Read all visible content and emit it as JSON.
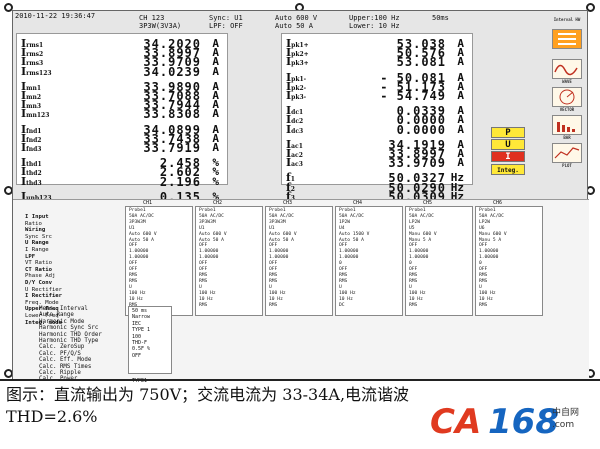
{
  "status": {
    "datetime": "2010-11-22 19:36:47",
    "channel": "CH 123",
    "wiring": "3P3W(3V3A)",
    "sync": "Sync: U1",
    "lpf": "LPF: OFF",
    "v_range": "Auto 600 V",
    "a_range": "Auto  50 A",
    "upper": "Upper:100 Hz",
    "lower": "Lower: 10 Hz",
    "interval": "50ms"
  },
  "left_rows": [
    {
      "sym": "I",
      "sub": "rms1",
      "val": "34.2020",
      "unit": "A"
    },
    {
      "sym": "I",
      "sub": "rms2",
      "val": "33.8997",
      "unit": "A"
    },
    {
      "sym": "I",
      "sub": "rms3",
      "val": "33.9709",
      "unit": "A"
    },
    {
      "sym": "I",
      "sub": "rms123",
      "val": "34.0239",
      "unit": "A"
    },
    {
      "sym": "I",
      "sub": "mn1",
      "val": "33.9890",
      "unit": "A"
    },
    {
      "sym": "I",
      "sub": "mn2",
      "val": "33.7088",
      "unit": "A"
    },
    {
      "sym": "I",
      "sub": "mn3",
      "val": "33.7944",
      "unit": "A"
    },
    {
      "sym": "I",
      "sub": "mn123",
      "val": "33.8308",
      "unit": "A"
    },
    {
      "sym": "I",
      "sub": "fnd1",
      "val": "34.0899",
      "unit": "A"
    },
    {
      "sym": "I",
      "sub": "fnd2",
      "val": "33.7438",
      "unit": "A"
    },
    {
      "sym": "I",
      "sub": "fnd3",
      "val": "33.7919",
      "unit": "A"
    },
    {
      "sym": "I",
      "sub": "thd1",
      "val": "2.458",
      "unit": "%"
    },
    {
      "sym": "I",
      "sub": "thd2",
      "val": "2.602",
      "unit": "%"
    },
    {
      "sym": "I",
      "sub": "thd3",
      "val": "2.196",
      "unit": "%"
    },
    {
      "sym": "I",
      "sub": "unb123",
      "val": "0.135",
      "unit": "%"
    }
  ],
  "right_rows": [
    {
      "sym": "I",
      "sub": "pk1+",
      "val": "53.038",
      "unit": "A"
    },
    {
      "sym": "I",
      "sub": "pk2+",
      "val": "50.576",
      "unit": "A"
    },
    {
      "sym": "I",
      "sub": "pk3+",
      "val": "53.081",
      "unit": "A"
    },
    {
      "sym": "I",
      "sub": "pk1-",
      "val": "- 50.081",
      "unit": "A"
    },
    {
      "sym": "I",
      "sub": "pk2-",
      "val": "- 51.173",
      "unit": "A"
    },
    {
      "sym": "I",
      "sub": "pk3-",
      "val": "- 54.749",
      "unit": "A"
    },
    {
      "sym": "I",
      "sub": "dc1",
      "val": "0.0339",
      "unit": "A"
    },
    {
      "sym": "I",
      "sub": "dc2",
      "val": "0.0000",
      "unit": "A"
    },
    {
      "sym": "I",
      "sub": "dc3",
      "val": "0.0000",
      "unit": "A"
    },
    {
      "sym": "I",
      "sub": "ac1",
      "val": "34.1919",
      "unit": "A"
    },
    {
      "sym": "I",
      "sub": "ac2",
      "val": "33.8997",
      "unit": "A"
    },
    {
      "sym": "I",
      "sub": "ac3",
      "val": "33.9709",
      "unit": "A"
    },
    {
      "sym": "f",
      "sub": "1",
      "val": "50.0327",
      "unit": "Hz"
    },
    {
      "sym": "f",
      "sub": "2",
      "val": "50.0290",
      "unit": "Hz"
    },
    {
      "sym": "f",
      "sub": "3",
      "val": "50.0309",
      "unit": "Hz"
    }
  ],
  "pui": {
    "p": "P",
    "u": "U",
    "i": "I",
    "integ": "Integ."
  },
  "sidebar": {
    "title": "Interval HW",
    "wave": "WAVE",
    "vector": "VECTOR",
    "bar": "BAR",
    "trend": "PLOT"
  },
  "setting_labels": [
    "I Input",
    "Ratio",
    "Wiring",
    "Sync Src",
    "U Range",
    "I Range",
    "LPF",
    "VT Ratio",
    "CT Ratio",
    "Phase Adj",
    "D/Y Conv",
    "U Rectifier",
    "I Rectifier",
    "Freq. Mode",
    "Upper Freq",
    "Lower Freq",
    "Integ. mode"
  ],
  "channels": [
    {
      "name": "CH1",
      "vals": [
        "Probe1",
        "50A AC/DC",
        "3P3W3M",
        "U1",
        "Auto 600 V",
        "Auto 50 A",
        "OFF",
        "1.00000",
        "1.00000",
        "OFF",
        "OFF",
        "RMS",
        "RMS",
        "U",
        "100 Hz",
        "10 Hz",
        "RMS"
      ]
    },
    {
      "name": "CH2",
      "vals": [
        "Probe1",
        "50A AC/DC",
        "3P3W3M",
        "U1",
        "Auto 600 V",
        "Auto 50 A",
        "OFF",
        "1.00000",
        "1.00000",
        "OFF",
        "OFF",
        "RMS",
        "RMS",
        "U",
        "100 Hz",
        "10 Hz",
        "RMS"
      ]
    },
    {
      "name": "CH3",
      "vals": [
        "Probe1",
        "50A AC/DC",
        "3P3W3M",
        "U1",
        "Auto 600 V",
        "Auto 50 A",
        "OFF",
        "1.00000",
        "1.00000",
        "OFF",
        "OFF",
        "RMS",
        "RMS",
        "U",
        "100 Hz",
        "10 Hz",
        "RMS"
      ]
    },
    {
      "name": "CH4",
      "vals": [
        "Probe1",
        "50A AC/DC",
        "1P2W",
        "U4",
        "Auto 1500 V",
        "Auto 50 A",
        "OFF",
        "1.00000",
        "1.00000",
        "0",
        "OFF",
        "RMS",
        "RMS",
        "U",
        "100 Hz",
        "10 Hz",
        "DC"
      ]
    },
    {
      "name": "CH5",
      "vals": [
        "Probe1",
        "50A AC/DC",
        "LP2W",
        "U5",
        "Manu 600 V",
        "Manu 5 A",
        "OFF",
        "1.00000",
        "1.00000",
        "0",
        "OFF",
        "RMS",
        "RMS",
        "U",
        "100 Hz",
        "10 Hz",
        "RMS"
      ]
    },
    {
      "name": "CH6",
      "vals": [
        "Probe1",
        "50A AC/DC",
        "LP2W",
        "U6",
        "Manu 600 V",
        "Manu 5 A",
        "OFF",
        "1.00000",
        "1.00000",
        "0",
        "OFF",
        "RMS",
        "RMS",
        "U",
        "100 Hz",
        "10 Hz",
        "RMS"
      ]
    }
  ],
  "lower_labels": [
    "Meas. Interval",
    "Auto Range",
    "Harmonic Mode",
    "Harmonic Sync Src",
    "Harmonic THD Order",
    "Harmonic THD Type",
    "Calc. ZeroSup",
    "Calc. PF/Q/S",
    "Calc. Eff. Mode",
    "Calc. RMS Times",
    "Calc. Ripple",
    "Calc. Power"
  ],
  "lower_vals": [
    "50 ms",
    "Narrow",
    "IEC",
    "TYPE 1",
    "100",
    "THD-F",
    "0.5F %",
    "OFF",
    "",
    "",
    "",
    "TYPE1"
  ],
  "caption": {
    "line1": "图示：直流输出为 750V；交流电流为 33-34A,电流谐波",
    "line2": "THD=2.6%"
  },
  "logo": {
    "ca": "CA",
    "num": "168",
    "cn": "中自网",
    "dom": ".com"
  }
}
